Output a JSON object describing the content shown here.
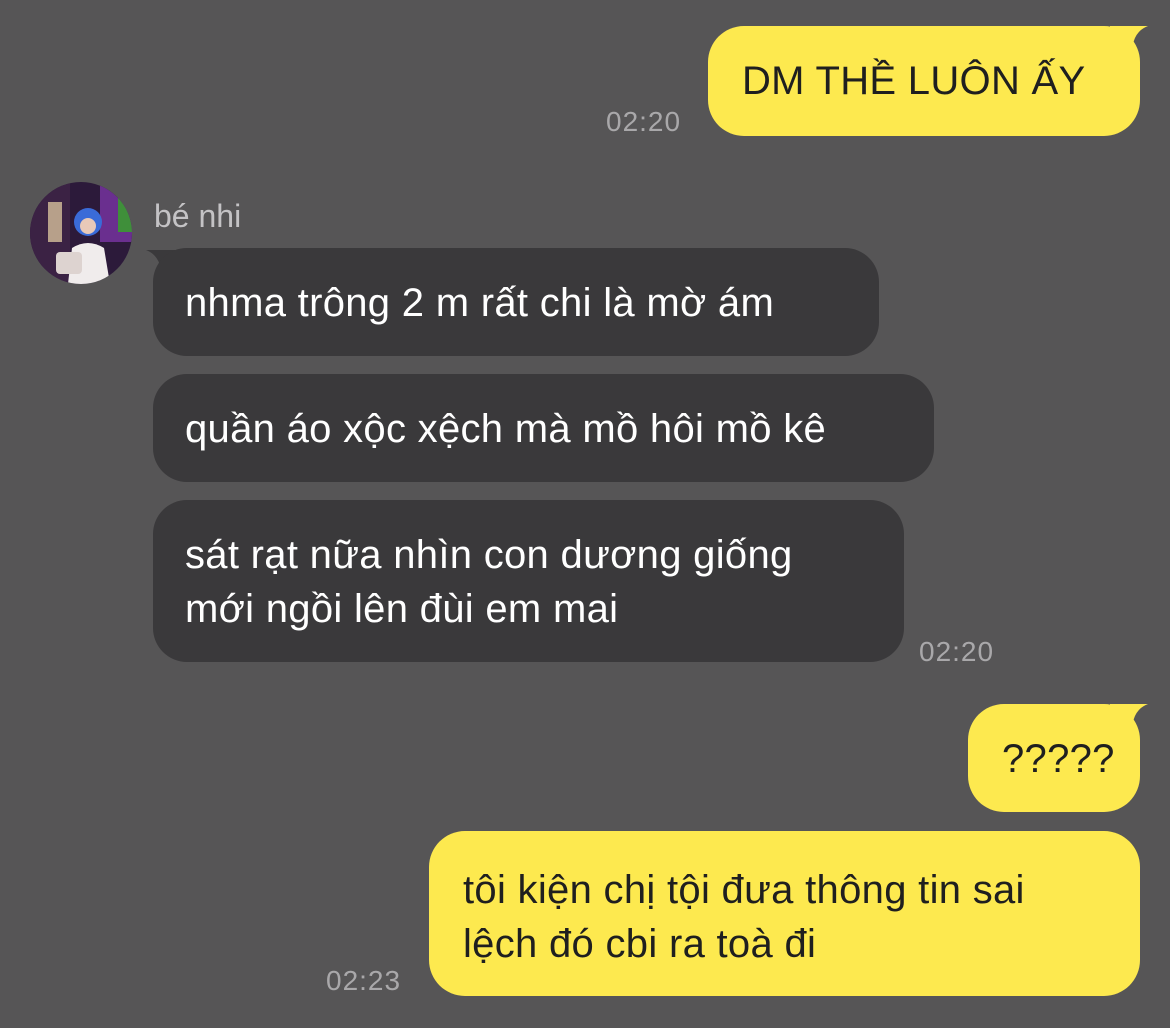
{
  "chat": {
    "contact_name": "bé nhi",
    "messages": [
      {
        "side": "out",
        "text": "DM THỀ LUÔN ẤY",
        "time": "02:20"
      },
      {
        "side": "in",
        "text": "nhma trông 2 m rất chi là mờ ám"
      },
      {
        "side": "in",
        "text": "quần áo xộc xệch mà mồ hôi mồ kê"
      },
      {
        "side": "in",
        "text_line1": "sát rạt nữa nhìn con dương giống",
        "text_line2": "mới ngồi lên đùi em mai",
        "time": "02:20"
      },
      {
        "side": "out",
        "text": "?????"
      },
      {
        "side": "out",
        "text_line1": "tôi kiện chị tội đưa thông tin sai",
        "text_line2": "lệch đó cbi ra toà đi",
        "time": "02:23"
      }
    ]
  },
  "colors": {
    "background": "#565556",
    "outgoing_bubble": "#fde94f",
    "incoming_bubble": "#3a393b"
  },
  "icons": {
    "avatar": "contact-avatar-photo"
  }
}
